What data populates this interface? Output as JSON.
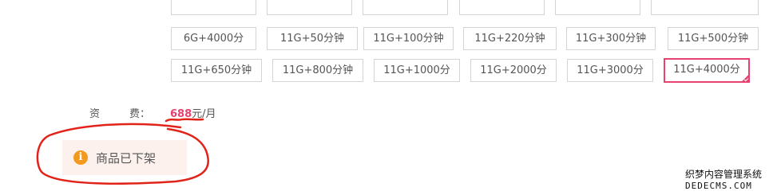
{
  "options_row0": [
    "",
    "",
    "",
    "",
    "",
    ""
  ],
  "options_row1": [
    "6G+4000分",
    "11G+50分钟",
    "11G+100分钟",
    "11G+220分钟",
    "11G+300分钟",
    "11G+500分钟"
  ],
  "options_row2": [
    "11G+650分钟",
    "11G+800分钟",
    "11G+1000分",
    "11G+2000分",
    "11G+3000分",
    "11G+4000分"
  ],
  "selected_option": "11G+4000分",
  "fee": {
    "label_1": "资",
    "label_2": "费：",
    "amount": "688",
    "unit": "元/月"
  },
  "notice": {
    "icon": "info-icon",
    "text": "商品已下架"
  },
  "watermark": {
    "line1": "织梦内容管理系统",
    "line2": "DEDECMS.COM"
  },
  "colors": {
    "accent": "#e8416f",
    "annotation": "#e2231a",
    "notice_bg": "#fdf1ee",
    "info_icon": "#f29a1f"
  }
}
